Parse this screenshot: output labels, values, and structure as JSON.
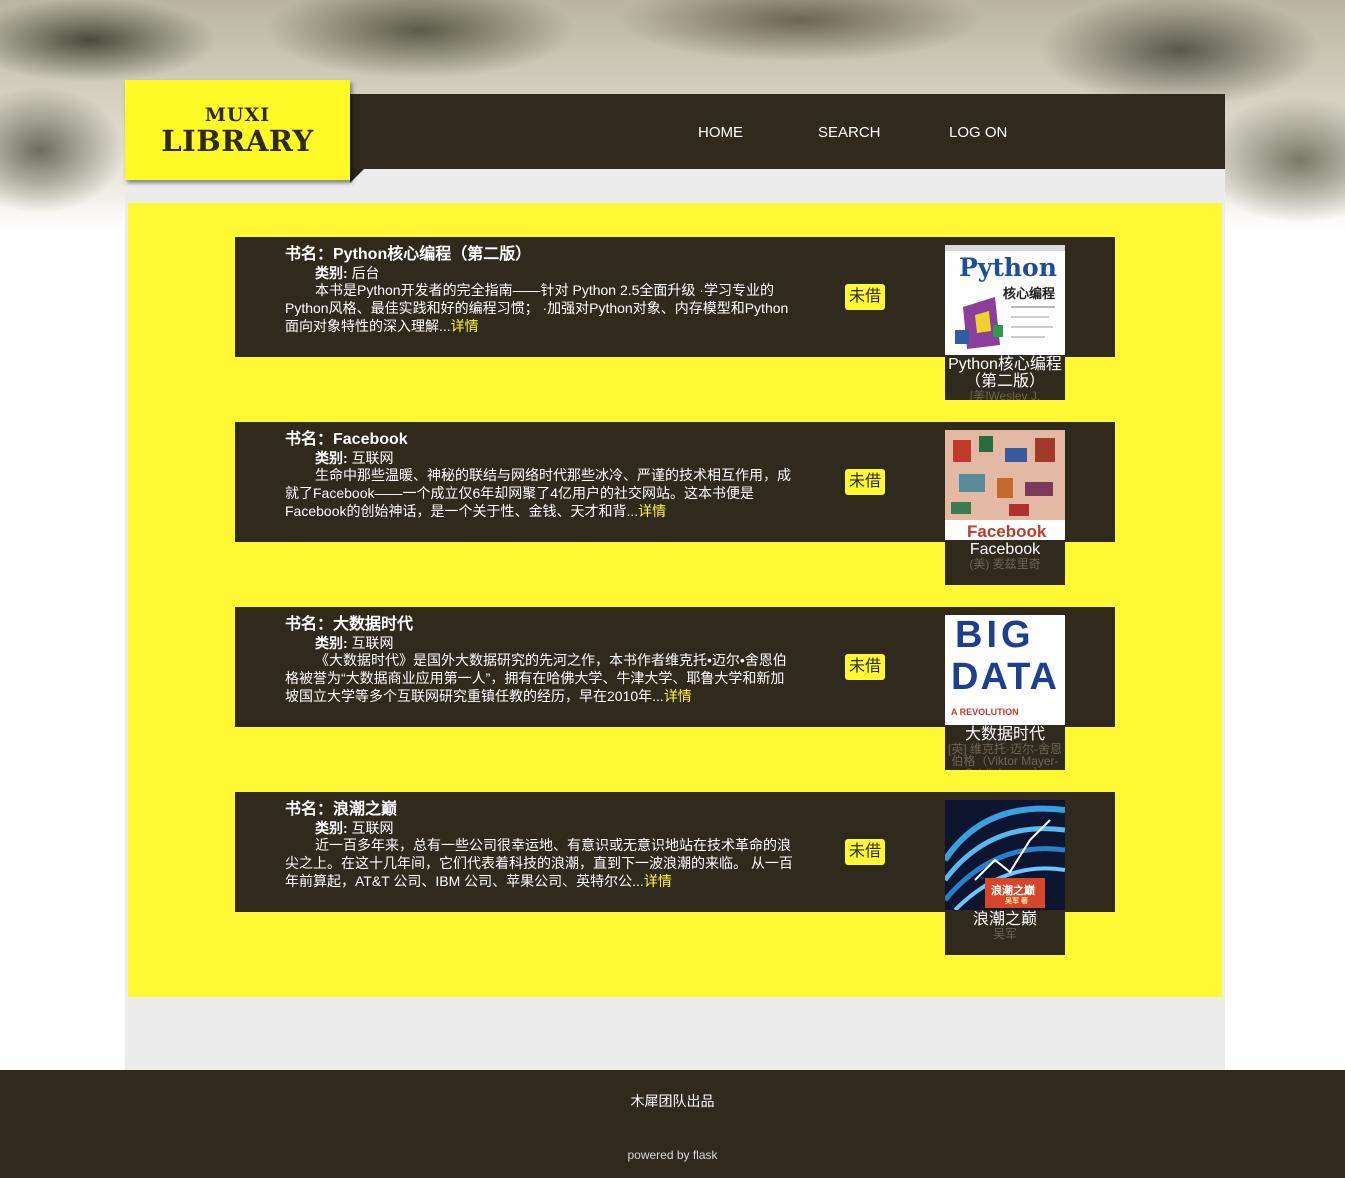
{
  "logo": {
    "top": "MUXI",
    "bottom": "LIBRARY"
  },
  "nav": {
    "home": "HOME",
    "search": "SEARCH",
    "logon": "LOG ON"
  },
  "books": [
    {
      "title": "书名：Python核心编程（第二版）",
      "category_label": "类别:",
      "category": "后台",
      "summary": "本书是Python开发者的完全指南——针对 Python 2.5全面升级 ·学习专业的Python风格、最佳实践和好的编程习惯； ·加强对Python对象、内存模型和Python面向对象特性的深入理解...",
      "details": "详情",
      "status": "未借",
      "card_title": "Python核心编程（第二版）",
      "card_author": "[美]Wesley J.",
      "cover_text": "Python",
      "cover_subtext": "核心编程"
    },
    {
      "title": "书名：Facebook",
      "category_label": "类别:",
      "category": "互联网",
      "summary": "生命中那些温暖、神秘的联结与网络时代那些冰冷、严谨的技术相互作用，成就了Facebook——一个成立仅6年却网聚了4亿用户的社交网站。这本书便是Facebook的创始神话，是一个关于性、金钱、天才和背...",
      "details": "详情",
      "status": "未借",
      "card_title": "Facebook",
      "card_author": "(美) 麦兹里奇",
      "cover_text": "Facebook"
    },
    {
      "title": "书名：大数据时代",
      "category_label": "类别:",
      "category": "互联网",
      "summary": "《大数据时代》是国外大数据研究的先河之作，本书作者维克托•迈尔•舍恩伯格被誉为“大数据商业应用第一人”，拥有在哈佛大学、牛津大学、耶鲁大学和新加坡国立大学等多个互联网研究重镇任教的经历，早在2010年...",
      "details": "详情",
      "status": "未借",
      "card_title": "大数据时代",
      "card_author": "[英] 维克托·迈尔-舍恩伯格（Viktor Mayer-Schönberger）",
      "cover_text": "BIG",
      "cover_subtext": "DATA",
      "cover_tagline": "A REVOLUTION"
    },
    {
      "title": "书名：浪潮之巅",
      "category_label": "类别:",
      "category": "互联网",
      "summary": "近一百多年来，总有一些公司很幸运地、有意识或无意识地站在技术革命的浪尖之上。在这十几年间，它们代表着科技的浪潮，直到下一波浪潮的来临。 从一百年前算起，AT&T 公司、IBM 公司、苹果公司、英特尔公...",
      "details": "详情",
      "status": "未借",
      "card_title": "浪潮之巅",
      "card_author": "吴军",
      "cover_text": "浪潮之巅",
      "cover_subtext": "吴军 著"
    }
  ],
  "footer": {
    "main": "木犀团队出品",
    "powered_prefix": "powered by ",
    "powered_link": "flask"
  },
  "colors": {
    "dark": "#302a1d",
    "yellow": "#fff832",
    "gray": "#ececec"
  }
}
